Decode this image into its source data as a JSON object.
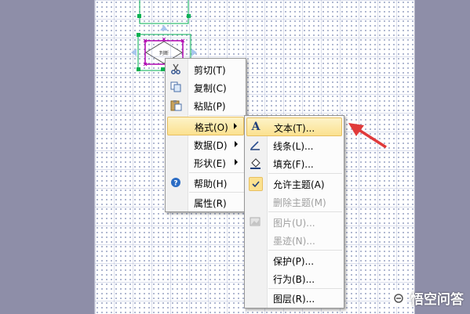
{
  "canvas": {
    "shape_text": "判断"
  },
  "context_menu": {
    "items": [
      {
        "label": "剪切(T)",
        "icon": "scissors-icon",
        "submenu": false
      },
      {
        "label": "复制(C)",
        "icon": "copy-icon",
        "submenu": false
      },
      {
        "label": "粘贴(P)",
        "icon": "paste-icon",
        "submenu": false
      },
      {
        "label": "格式(O)",
        "submenu": true,
        "highlighted": true
      },
      {
        "label": "数据(D)",
        "submenu": true
      },
      {
        "label": "形状(E)",
        "submenu": true
      },
      {
        "label": "帮助(H)",
        "icon": "help-icon",
        "submenu": false
      },
      {
        "label": "属性(R)",
        "submenu": false
      }
    ]
  },
  "format_submenu": {
    "items": [
      {
        "label": "文本(T)...",
        "icon": "text-a-icon",
        "highlighted": true
      },
      {
        "label": "线条(L)...",
        "icon": "line-icon"
      },
      {
        "label": "填充(F)...",
        "icon": "fill-icon"
      },
      {
        "label": "允许主题(A)",
        "icon": "checkmark-icon",
        "checked": true
      },
      {
        "label": "删除主题(M)",
        "disabled": true
      },
      {
        "label": "图片(U)...",
        "icon": "picture-icon",
        "disabled": true
      },
      {
        "label": "墨迹(N)...",
        "disabled": true
      },
      {
        "label": "保护(P)...",
        "icon": ""
      },
      {
        "label": "行为(B)...",
        "icon": ""
      },
      {
        "label": "图层(R)...",
        "icon": ""
      }
    ]
  },
  "watermark": {
    "text": "悟空问答"
  },
  "colors": {
    "arrow": "#e03a3a",
    "highlight": "#fbe18f",
    "selection": "#00b050",
    "shape_outline": "#b000b0"
  }
}
